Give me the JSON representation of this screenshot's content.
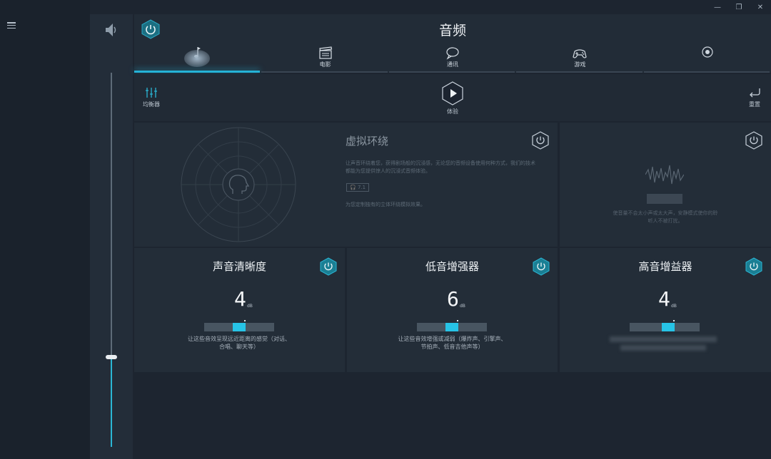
{
  "window": {
    "minimize_label": "—",
    "maximize_label": "❐",
    "close_label": "✕"
  },
  "app": {
    "title": "音频"
  },
  "tabs": [
    {
      "label": "",
      "icon": "music-note-icon",
      "active": true
    },
    {
      "label": "电影",
      "icon": "clapperboard-icon",
      "active": false
    },
    {
      "label": "通讯",
      "icon": "chat-bubble-icon",
      "active": false
    },
    {
      "label": "游戏",
      "icon": "gamepad-icon",
      "active": false
    },
    {
      "label": "",
      "icon": "custom-profile-icon",
      "active": false
    }
  ],
  "toolbar": {
    "equalizer_label": "均衡器",
    "preview_label": "体验",
    "reset_label": "重置"
  },
  "virtual_surround": {
    "title": "虚拟环绕",
    "description": "让声音环绕着您，获得剧场般的沉浸感，无论您的音频设备使用何种方式，我们的技术都能为您提供惊人的沉浸式音频体验。",
    "chip_label": "7.1",
    "note": "为您定制独有的立体环绕模拟效果。"
  },
  "noise_panel": {
    "description": "使音量不会太小声或太大声，安静模式使你的聆听人不被打扰。"
  },
  "cards": [
    {
      "title": "声音清晰度",
      "value": "4",
      "unit": "dB",
      "level": 0.5,
      "description": "让这些音效呈现远近距离的感觉（对话、合唱、聊天等）"
    },
    {
      "title": "低音增强器",
      "value": "6",
      "unit": "dB",
      "level": 0.5,
      "description": "让这些音效增强或减弱（爆炸声、引擎声、节拍声、低音吉他声等）"
    },
    {
      "title": "高音增益器",
      "value": "4",
      "unit": "dB",
      "level": 0.55,
      "description": ""
    }
  ],
  "volume": {
    "level": 0.24
  },
  "colors": {
    "accent": "#25b2d6",
    "power_hex": "#1a7f94"
  }
}
